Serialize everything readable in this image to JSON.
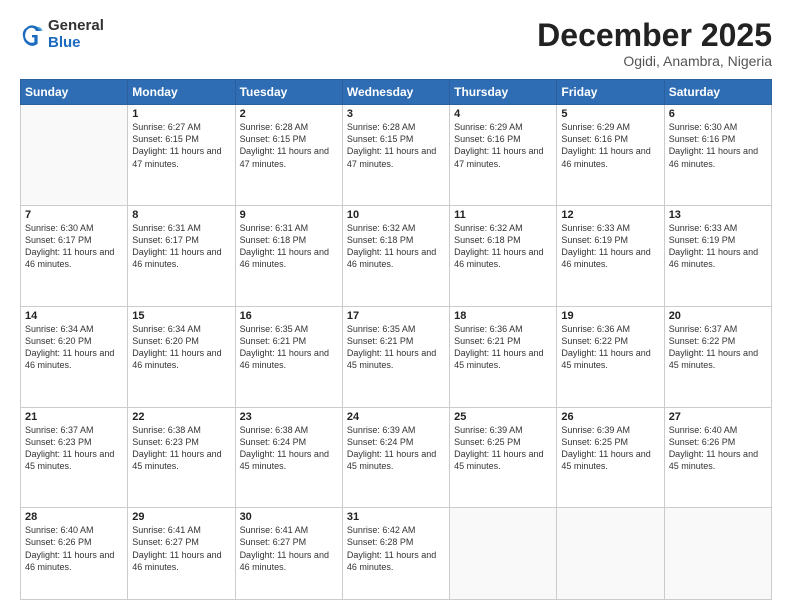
{
  "logo": {
    "general": "General",
    "blue": "Blue"
  },
  "header": {
    "month": "December 2025",
    "location": "Ogidi, Anambra, Nigeria"
  },
  "days_of_week": [
    "Sunday",
    "Monday",
    "Tuesday",
    "Wednesday",
    "Thursday",
    "Friday",
    "Saturday"
  ],
  "weeks": [
    [
      {
        "day": "",
        "sunrise": "",
        "sunset": "",
        "daylight": ""
      },
      {
        "day": "1",
        "sunrise": "Sunrise: 6:27 AM",
        "sunset": "Sunset: 6:15 PM",
        "daylight": "Daylight: 11 hours and 47 minutes."
      },
      {
        "day": "2",
        "sunrise": "Sunrise: 6:28 AM",
        "sunset": "Sunset: 6:15 PM",
        "daylight": "Daylight: 11 hours and 47 minutes."
      },
      {
        "day": "3",
        "sunrise": "Sunrise: 6:28 AM",
        "sunset": "Sunset: 6:15 PM",
        "daylight": "Daylight: 11 hours and 47 minutes."
      },
      {
        "day": "4",
        "sunrise": "Sunrise: 6:29 AM",
        "sunset": "Sunset: 6:16 PM",
        "daylight": "Daylight: 11 hours and 47 minutes."
      },
      {
        "day": "5",
        "sunrise": "Sunrise: 6:29 AM",
        "sunset": "Sunset: 6:16 PM",
        "daylight": "Daylight: 11 hours and 46 minutes."
      },
      {
        "day": "6",
        "sunrise": "Sunrise: 6:30 AM",
        "sunset": "Sunset: 6:16 PM",
        "daylight": "Daylight: 11 hours and 46 minutes."
      }
    ],
    [
      {
        "day": "7",
        "sunrise": "Sunrise: 6:30 AM",
        "sunset": "Sunset: 6:17 PM",
        "daylight": "Daylight: 11 hours and 46 minutes."
      },
      {
        "day": "8",
        "sunrise": "Sunrise: 6:31 AM",
        "sunset": "Sunset: 6:17 PM",
        "daylight": "Daylight: 11 hours and 46 minutes."
      },
      {
        "day": "9",
        "sunrise": "Sunrise: 6:31 AM",
        "sunset": "Sunset: 6:18 PM",
        "daylight": "Daylight: 11 hours and 46 minutes."
      },
      {
        "day": "10",
        "sunrise": "Sunrise: 6:32 AM",
        "sunset": "Sunset: 6:18 PM",
        "daylight": "Daylight: 11 hours and 46 minutes."
      },
      {
        "day": "11",
        "sunrise": "Sunrise: 6:32 AM",
        "sunset": "Sunset: 6:18 PM",
        "daylight": "Daylight: 11 hours and 46 minutes."
      },
      {
        "day": "12",
        "sunrise": "Sunrise: 6:33 AM",
        "sunset": "Sunset: 6:19 PM",
        "daylight": "Daylight: 11 hours and 46 minutes."
      },
      {
        "day": "13",
        "sunrise": "Sunrise: 6:33 AM",
        "sunset": "Sunset: 6:19 PM",
        "daylight": "Daylight: 11 hours and 46 minutes."
      }
    ],
    [
      {
        "day": "14",
        "sunrise": "Sunrise: 6:34 AM",
        "sunset": "Sunset: 6:20 PM",
        "daylight": "Daylight: 11 hours and 46 minutes."
      },
      {
        "day": "15",
        "sunrise": "Sunrise: 6:34 AM",
        "sunset": "Sunset: 6:20 PM",
        "daylight": "Daylight: 11 hours and 46 minutes."
      },
      {
        "day": "16",
        "sunrise": "Sunrise: 6:35 AM",
        "sunset": "Sunset: 6:21 PM",
        "daylight": "Daylight: 11 hours and 46 minutes."
      },
      {
        "day": "17",
        "sunrise": "Sunrise: 6:35 AM",
        "sunset": "Sunset: 6:21 PM",
        "daylight": "Daylight: 11 hours and 45 minutes."
      },
      {
        "day": "18",
        "sunrise": "Sunrise: 6:36 AM",
        "sunset": "Sunset: 6:21 PM",
        "daylight": "Daylight: 11 hours and 45 minutes."
      },
      {
        "day": "19",
        "sunrise": "Sunrise: 6:36 AM",
        "sunset": "Sunset: 6:22 PM",
        "daylight": "Daylight: 11 hours and 45 minutes."
      },
      {
        "day": "20",
        "sunrise": "Sunrise: 6:37 AM",
        "sunset": "Sunset: 6:22 PM",
        "daylight": "Daylight: 11 hours and 45 minutes."
      }
    ],
    [
      {
        "day": "21",
        "sunrise": "Sunrise: 6:37 AM",
        "sunset": "Sunset: 6:23 PM",
        "daylight": "Daylight: 11 hours and 45 minutes."
      },
      {
        "day": "22",
        "sunrise": "Sunrise: 6:38 AM",
        "sunset": "Sunset: 6:23 PM",
        "daylight": "Daylight: 11 hours and 45 minutes."
      },
      {
        "day": "23",
        "sunrise": "Sunrise: 6:38 AM",
        "sunset": "Sunset: 6:24 PM",
        "daylight": "Daylight: 11 hours and 45 minutes."
      },
      {
        "day": "24",
        "sunrise": "Sunrise: 6:39 AM",
        "sunset": "Sunset: 6:24 PM",
        "daylight": "Daylight: 11 hours and 45 minutes."
      },
      {
        "day": "25",
        "sunrise": "Sunrise: 6:39 AM",
        "sunset": "Sunset: 6:25 PM",
        "daylight": "Daylight: 11 hours and 45 minutes."
      },
      {
        "day": "26",
        "sunrise": "Sunrise: 6:39 AM",
        "sunset": "Sunset: 6:25 PM",
        "daylight": "Daylight: 11 hours and 45 minutes."
      },
      {
        "day": "27",
        "sunrise": "Sunrise: 6:40 AM",
        "sunset": "Sunset: 6:26 PM",
        "daylight": "Daylight: 11 hours and 45 minutes."
      }
    ],
    [
      {
        "day": "28",
        "sunrise": "Sunrise: 6:40 AM",
        "sunset": "Sunset: 6:26 PM",
        "daylight": "Daylight: 11 hours and 46 minutes."
      },
      {
        "day": "29",
        "sunrise": "Sunrise: 6:41 AM",
        "sunset": "Sunset: 6:27 PM",
        "daylight": "Daylight: 11 hours and 46 minutes."
      },
      {
        "day": "30",
        "sunrise": "Sunrise: 6:41 AM",
        "sunset": "Sunset: 6:27 PM",
        "daylight": "Daylight: 11 hours and 46 minutes."
      },
      {
        "day": "31",
        "sunrise": "Sunrise: 6:42 AM",
        "sunset": "Sunset: 6:28 PM",
        "daylight": "Daylight: 11 hours and 46 minutes."
      },
      {
        "day": "",
        "sunrise": "",
        "sunset": "",
        "daylight": ""
      },
      {
        "day": "",
        "sunrise": "",
        "sunset": "",
        "daylight": ""
      },
      {
        "day": "",
        "sunrise": "",
        "sunset": "",
        "daylight": ""
      }
    ]
  ]
}
